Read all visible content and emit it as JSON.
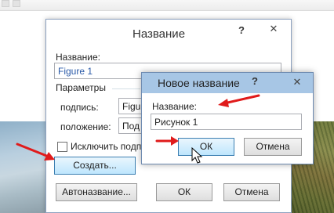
{
  "main_dialog": {
    "title": "Название",
    "help": "?",
    "close": "✕",
    "caption_label": "Название:",
    "caption_value": "Figure 1",
    "params_label": "Параметры",
    "label_label": "подпись:",
    "label_value": "Figure",
    "position_label": "положение:",
    "position_value": "Под е",
    "exclude_label": "Исключить подпи",
    "create_button": "Создать...",
    "autocaption_button": "Автоназвание...",
    "ok_button": "ОК",
    "cancel_button": "Отмена"
  },
  "new_dialog": {
    "title": "Новое название",
    "help": "?",
    "close": "✕",
    "name_label": "Название:",
    "name_value": "Рисунок 1",
    "ok_button": "ОК",
    "cancel_button": "Отмена"
  },
  "colors": {
    "arrow": "#e01b1b",
    "accent_title": "#a7c6e5",
    "field_blue_text": "#2a5aa8"
  }
}
